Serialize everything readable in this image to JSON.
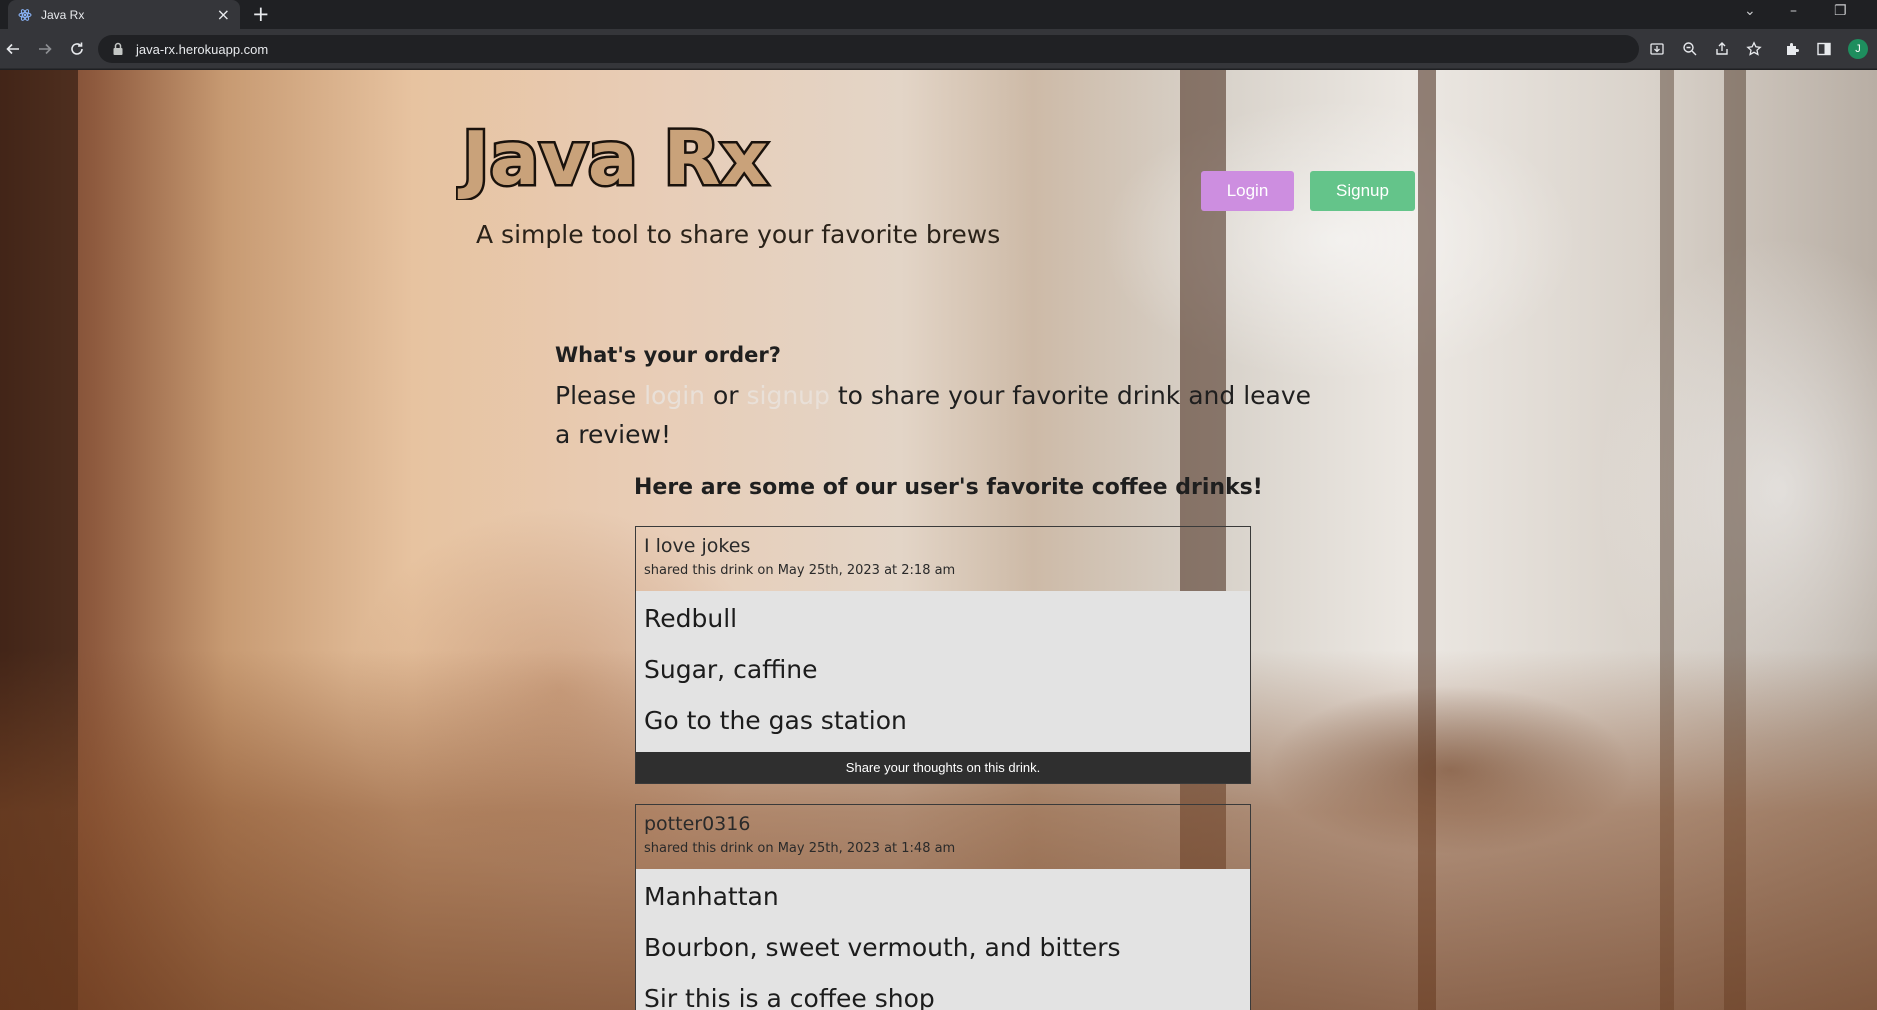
{
  "browser": {
    "tab_title": "Java Rx",
    "url": "java-rx.herokuapp.com",
    "profile_initial": "J"
  },
  "header": {
    "logo_text": "Java Rx",
    "tagline": "A simple tool to share your favorite brews",
    "login_label": "Login",
    "signup_label": "Signup"
  },
  "order": {
    "heading": "What's your order?",
    "text_please": "Please",
    "link_login": "login",
    "text_or": "or",
    "link_signup": "signup",
    "text_rest": "to share your favorite drink and leave a review!"
  },
  "feed": {
    "heading": "Here are some of our user's favorite coffee drinks!",
    "drinks": [
      {
        "user": "I love jokes",
        "date": "shared this drink on May 25th, 2023 at 2:18 am",
        "name": "Redbull",
        "ingredients": "Sugar, caffine",
        "instructions": "Go to the gas station",
        "action": "Share your thoughts on this drink."
      },
      {
        "user": "potter0316",
        "date": "shared this drink on May 25th, 2023 at 1:48 am",
        "name": "Manhattan",
        "ingredients": "Bourbon, sweet vermouth, and bitters",
        "instructions": "Sir this is a coffee shop"
      }
    ]
  },
  "colors": {
    "login_button": "#cd8ee0",
    "signup_button": "#64c48a",
    "card_body": "#e3e3e3",
    "card_footer": "#2f2f2f"
  }
}
